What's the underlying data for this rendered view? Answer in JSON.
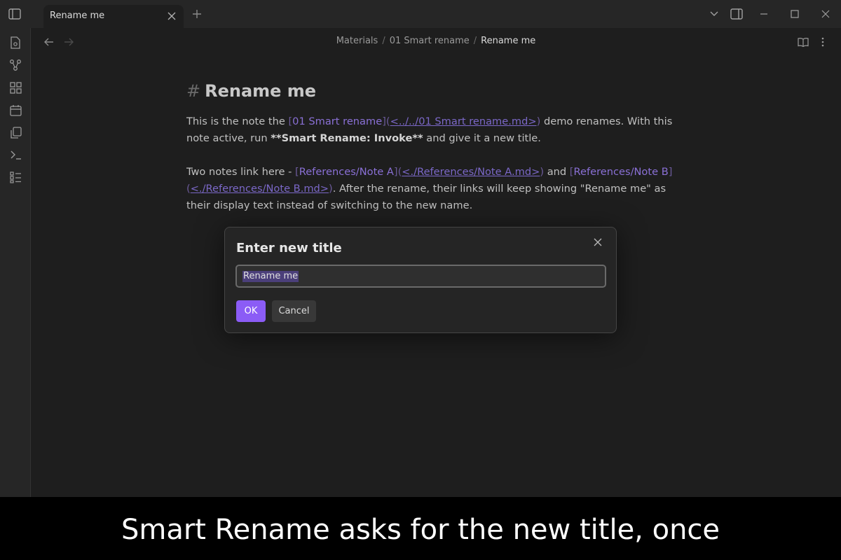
{
  "tab": {
    "label": "Rename me"
  },
  "breadcrumb": {
    "parts": [
      "Materials",
      "01 Smart rename",
      "Rename me"
    ]
  },
  "note": {
    "heading_mark": "#",
    "heading": "Rename me",
    "p1": {
      "t1": "This is the note the ",
      "link_text": "01 Smart rename",
      "link_url": "<../../01 Smart rename.md>",
      "t2": " demo renames. With this note active, run ",
      "bold_mark_open": "**",
      "bold_text": "Smart Rename: Invoke",
      "bold_mark_close": "**",
      "t3": " and give it a new title."
    },
    "p2": {
      "t1": "Two notes link here - ",
      "link1_text": "References/Note A",
      "link1_url": "<./References/Note A.md>",
      "t2": " and ",
      "link2_text": "References/Note B",
      "link2_url": "<./References/Note B.md>",
      "t3": ". After the rename, their links will keep showing \"Rename me\" as their display text instead of switching to the new name."
    }
  },
  "modal": {
    "title": "Enter new title",
    "input_value": "Rename me",
    "ok_label": "OK",
    "cancel_label": "Cancel"
  },
  "caption": "Smart Rename asks for the new title, once",
  "colors": {
    "accent": "#8b5cf6",
    "link": "#8a70d6",
    "background": "#1e1e1e"
  },
  "icons": [
    "sidebar-toggle-icon",
    "close-icon",
    "plus-icon",
    "chevron-down-icon",
    "layout-icon",
    "minimize-icon",
    "maximize-icon",
    "file-icon",
    "graph-icon",
    "grid-icon",
    "calendar-icon",
    "copy-icon",
    "terminal-icon",
    "list-icon",
    "arrow-left-icon",
    "arrow-right-icon",
    "book-icon",
    "more-vertical-icon"
  ]
}
